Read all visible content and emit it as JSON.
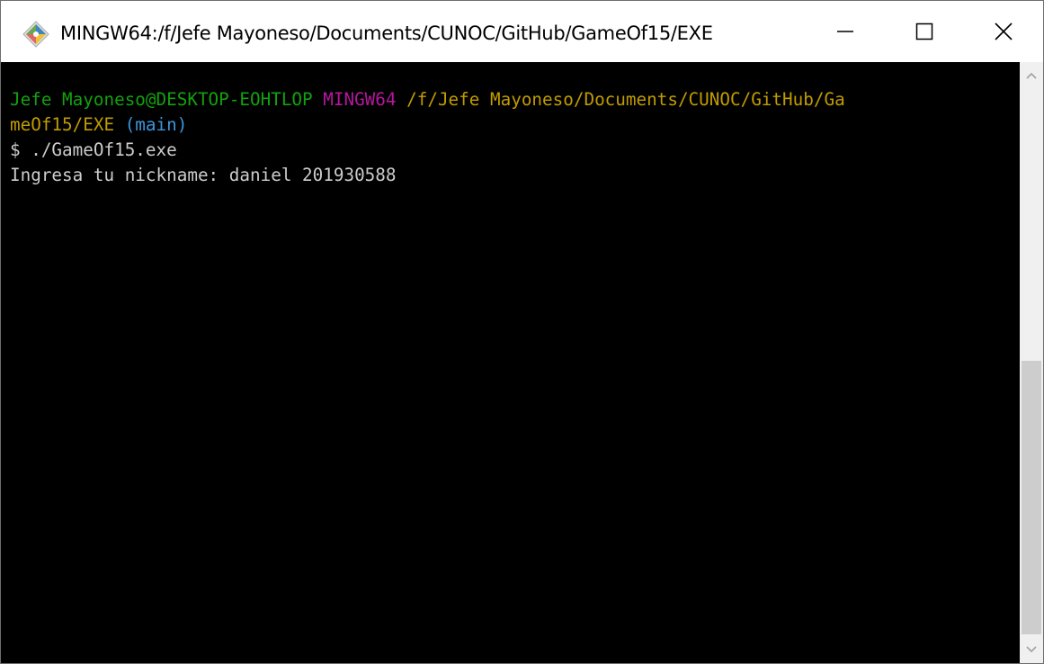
{
  "window": {
    "title": "MINGW64:/f/Jefe Mayoneso/Documents/CUNOC/GitHub/GameOf15/EXE",
    "icon": "git-bash-icon",
    "controls": [
      "minimize-icon",
      "maximize-icon",
      "close-icon"
    ]
  },
  "terminal": {
    "prompt": {
      "user_host": "Jefe Mayoneso@DESKTOP-EOHTLOP",
      "env": "MINGW64",
      "path_part1": "/f/Jefe Mayoneso/Documents/CUNOC/GitHub/Ga",
      "path_part2": "meOf15/EXE",
      "branch": "(main)"
    },
    "command_line": "$ ./GameOf15.exe",
    "output_line": "Ingresa tu nickname: daniel 201930588"
  },
  "colors": {
    "user_host": "#13a10e",
    "env": "#b5179e",
    "path": "#c19c00",
    "branch": "#3a96dd",
    "text": "#cccccc",
    "background": "#000000"
  },
  "scrollbar": {
    "position_fraction": 1.0
  }
}
